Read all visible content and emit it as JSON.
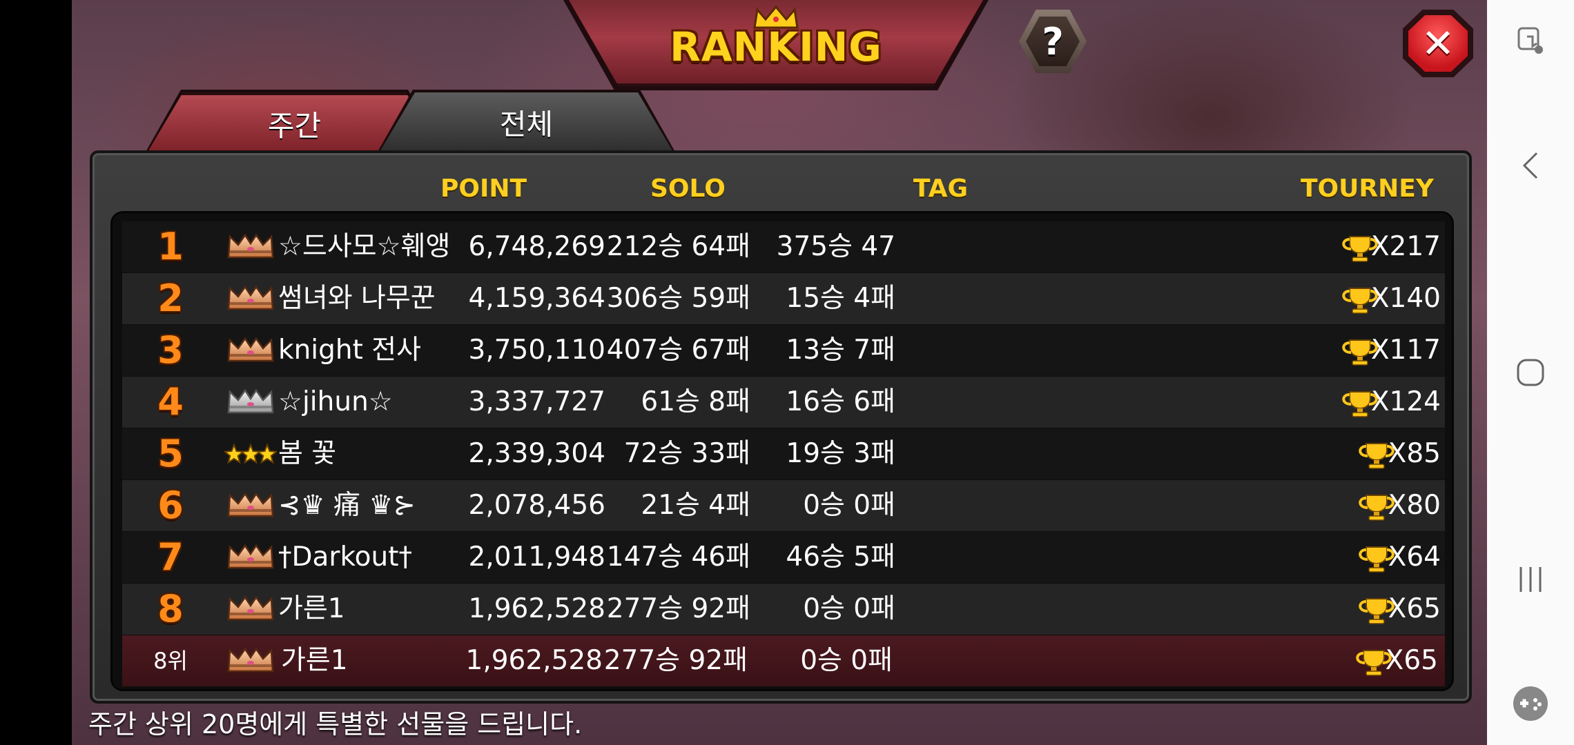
{
  "title": "RANKING",
  "help_label": "?",
  "close_label": "✕",
  "tabs": [
    {
      "label": "주간",
      "active": true
    },
    {
      "label": "전체",
      "active": false
    }
  ],
  "columns": {
    "point": "POINT",
    "solo": "SOLO",
    "tag": "TAG",
    "tourney": "TOURNEY"
  },
  "rows": [
    {
      "rank": "1",
      "tier": "bronze-crown-icon",
      "name": "☆드사모☆훼앵",
      "point": "6,748,269",
      "solo": "212승 64패",
      "tag": "375승 47패",
      "tourney": "X217"
    },
    {
      "rank": "2",
      "tier": "bronze-crown-icon",
      "name": "썸녀와 나무꾼",
      "point": "4,159,364",
      "solo": "306승 59패",
      "tag": "15승 4패",
      "tourney": "X140"
    },
    {
      "rank": "3",
      "tier": "bronze-crown-icon",
      "name": "knight 전사",
      "point": "3,750,110",
      "solo": "407승 67패",
      "tag": "13승 7패",
      "tourney": "X117"
    },
    {
      "rank": "4",
      "tier": "silver-crown-icon",
      "name": "☆jihun☆",
      "point": "3,337,727",
      "solo": "61승 8패",
      "tag": "16승 6패",
      "tourney": "X124"
    },
    {
      "rank": "5",
      "tier": "three-stars-icon",
      "name": "봄  꽃",
      "point": "2,339,304",
      "solo": "72승 33패",
      "tag": "19승 3패",
      "tourney": "X85"
    },
    {
      "rank": "6",
      "tier": "bronze-crown-icon",
      "name": "⊰♛ 痛 ♛⊱",
      "point": "2,078,456",
      "solo": "21승 4패",
      "tag": "0승 0패",
      "tourney": "X80"
    },
    {
      "rank": "7",
      "tier": "bronze-crown-icon",
      "name": "†Darkout†",
      "point": "2,011,948",
      "solo": "147승 46패",
      "tag": "46승 5패",
      "tourney": "X64"
    },
    {
      "rank": "8",
      "tier": "bronze-crown-icon",
      "name": "가른1",
      "point": "1,962,528",
      "solo": "277승 92패",
      "tag": "0승 0패",
      "tourney": "X65"
    }
  ],
  "my_rank": {
    "rank": "8위",
    "tier": "bronze-crown-icon",
    "name": "가른1",
    "point": "1,962,528",
    "solo": "277승 92패",
    "tag": "0승 0패",
    "tourney": "X65"
  },
  "footer": "주간 상위 20명에게 특별한 선물을 드립니다.",
  "colors": {
    "accent": "#ffcf1f",
    "rank": "#ff8a1a",
    "close": "#c8141c"
  },
  "system_nav": [
    "screen-recorder-icon",
    "back-icon",
    "home-icon",
    "recents-icon",
    "game-tools-icon"
  ]
}
